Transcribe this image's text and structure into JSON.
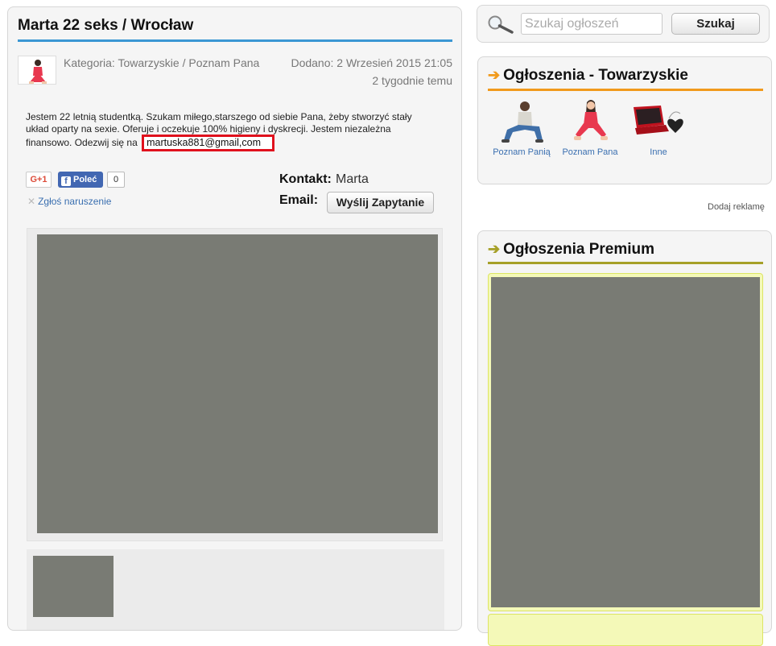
{
  "listing": {
    "title": "Marta 22 seks / Wrocław",
    "category": "Kategoria: Towarzyskie / Poznam Pana",
    "added": "Dodano: 2 Wrzesień 2015 21:05",
    "ago": "2 tygodnie temu",
    "description": "Jestem 22 letnią studentką. Szukam miłego,starszego od siebie Pana, żeby stworzyć stały układ oparty na sexie. Oferuje i oczekuje 100% higieny i dyskrecji. Jestem niezależna finansowo. Odezwij się na",
    "email_text": "martuska881@gmail,com",
    "highlight_color": "#e0111d"
  },
  "social": {
    "gplus_label": "G+1",
    "fb_icon": "f",
    "fb_label": "Poleć",
    "fb_count": "0",
    "report_label": "Zgłoś naruszenie"
  },
  "contact": {
    "label": "Kontakt:",
    "name": "Marta",
    "email_label": "Email:",
    "send_button": "Wyślij Zapytanie"
  },
  "search": {
    "placeholder": "Szukaj ogłoszeń",
    "button": "Szukaj"
  },
  "categories_box": {
    "arrow": "➔",
    "title": "Ogłoszenia - Towarzyskie",
    "accent": "#f19a1c",
    "items": [
      {
        "label": "Poznam Panią",
        "icon": "man-sitting-icon"
      },
      {
        "label": "Poznam Pana",
        "icon": "woman-sitting-icon"
      },
      {
        "label": "Inne",
        "icon": "laptop-heart-icon"
      }
    ]
  },
  "add_ad": "Dodaj reklamę",
  "premium": {
    "arrow": "➔",
    "title": "Ogłoszenia Premium",
    "accent": "#a6a028"
  }
}
